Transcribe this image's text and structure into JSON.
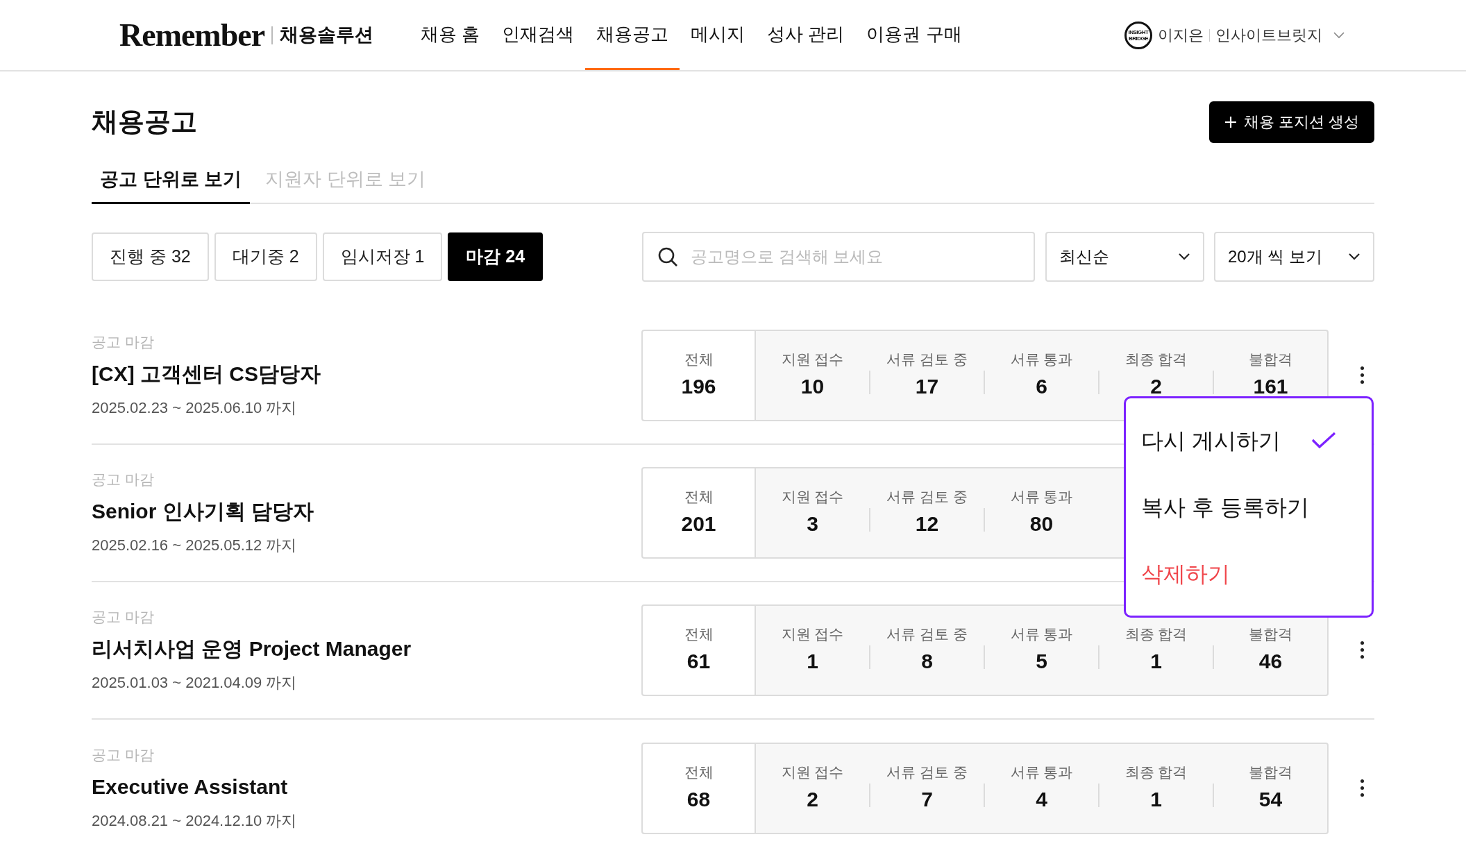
{
  "header": {
    "logo": "Remember",
    "product": "채용솔루션",
    "nav": [
      {
        "label": "채용 홈",
        "selected": false
      },
      {
        "label": "인재검색",
        "selected": false
      },
      {
        "label": "채용공고",
        "selected": true
      },
      {
        "label": "메시지",
        "selected": false
      },
      {
        "label": "성사 관리",
        "selected": false
      },
      {
        "label": "이용권 구매",
        "selected": false
      }
    ],
    "account": {
      "badge_lines": [
        "INSIGHT",
        "BRIDGE"
      ],
      "user": "이지은",
      "company": "인사이트브릿지"
    }
  },
  "page": {
    "title": "채용공고",
    "create_button": "채용 포지션 생성",
    "tabs": [
      {
        "label": "공고 단위로 보기",
        "selected": true
      },
      {
        "label": "지원자 단위로 보기",
        "selected": false
      }
    ],
    "filters": [
      {
        "label": "진행 중 32",
        "selected": false
      },
      {
        "label": "대기중 2",
        "selected": false
      },
      {
        "label": "임시저장 1",
        "selected": false
      },
      {
        "label": "마감 24",
        "selected": true
      }
    ],
    "search": {
      "placeholder": "공고명으로 검색해 보세요"
    },
    "sort": "최신순",
    "page_size": "20개 씩 보기"
  },
  "postings": [
    {
      "status": "공고 마감",
      "title": "[CX] 고객센터 CS담당자",
      "period": "2025.02.23 ~ 2025.06.10 까지",
      "total_label": "전체",
      "total": "196",
      "menu_open": true,
      "stats": [
        {
          "label": "지원 접수",
          "value": "10"
        },
        {
          "label": "서류 검토 중",
          "value": "17"
        },
        {
          "label": "서류 통과",
          "value": "6"
        },
        {
          "label": "최종 합격",
          "value": "2"
        },
        {
          "label": "불합격",
          "value": "161"
        }
      ]
    },
    {
      "status": "공고 마감",
      "title": "Senior 인사기획 담당자",
      "period": "2025.02.16 ~ 2025.05.12 까지",
      "total_label": "전체",
      "total": "201",
      "menu_open": false,
      "stats": [
        {
          "label": "지원 접수",
          "value": "3"
        },
        {
          "label": "서류 검토 중",
          "value": "12"
        },
        {
          "label": "서류 통과",
          "value": "80"
        }
      ]
    },
    {
      "status": "공고 마감",
      "title": "리서치사업 운영 Project Manager",
      "period": "2025.01.03 ~ 2021.04.09 까지",
      "total_label": "전체",
      "total": "61",
      "menu_open": false,
      "stats": [
        {
          "label": "지원 접수",
          "value": "1"
        },
        {
          "label": "서류 검토 중",
          "value": "8"
        },
        {
          "label": "서류 통과",
          "value": "5"
        },
        {
          "label": "최종 합격",
          "value": "1"
        },
        {
          "label": "불합격",
          "value": "46"
        }
      ]
    },
    {
      "status": "공고 마감",
      "title": "Executive Assistant",
      "period": "2024.08.21 ~ 2024.12.10 까지",
      "total_label": "전체",
      "total": "68",
      "menu_open": false,
      "stats": [
        {
          "label": "지원 접수",
          "value": "2"
        },
        {
          "label": "서류 검토 중",
          "value": "7"
        },
        {
          "label": "서류 통과",
          "value": "4"
        },
        {
          "label": "최종 합격",
          "value": "1"
        },
        {
          "label": "불합격",
          "value": "54"
        }
      ]
    }
  ],
  "menu": {
    "items": [
      {
        "label": "다시 게시하기",
        "kind": "normal",
        "checked": true
      },
      {
        "label": "복사 후 등록하기",
        "kind": "normal",
        "checked": false
      },
      {
        "label": "삭제하기",
        "kind": "danger",
        "checked": false
      }
    ]
  }
}
